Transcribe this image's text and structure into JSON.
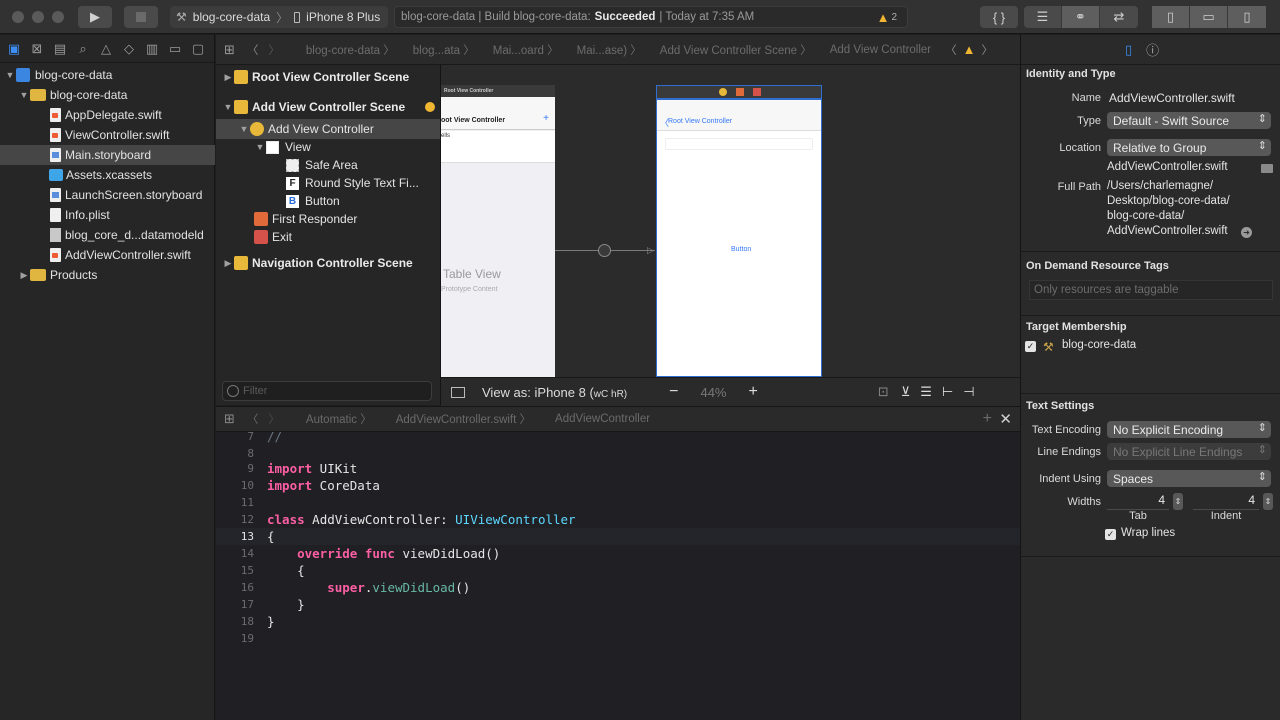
{
  "toolbar": {
    "scheme_target": "blog-core-data",
    "scheme_device": "iPhone 8 Plus",
    "status_prefix": "blog-core-data | Build blog-core-data:",
    "status_result": "Succeeded",
    "status_time": "| Today at 7:35 AM",
    "warning_count": "2"
  },
  "navigator": {
    "items": [
      {
        "label": "blog-core-data",
        "kind": "project"
      },
      {
        "label": "blog-core-data",
        "kind": "folder"
      },
      {
        "label": "AppDelegate.swift",
        "kind": "swift"
      },
      {
        "label": "ViewController.swift",
        "kind": "swift"
      },
      {
        "label": "Main.storyboard",
        "kind": "storyboard"
      },
      {
        "label": "Assets.xcassets",
        "kind": "assets"
      },
      {
        "label": "LaunchScreen.storyboard",
        "kind": "storyboard"
      },
      {
        "label": "Info.plist",
        "kind": "plist"
      },
      {
        "label": "blog_core_d...datamodeld",
        "kind": "datamodel"
      },
      {
        "label": "AddViewController.swift",
        "kind": "swift"
      },
      {
        "label": "Products",
        "kind": "folder"
      }
    ]
  },
  "jumpbar": {
    "crumbs": [
      "blog-core-data 〉",
      "blog...ata 〉",
      "Mai...oard 〉",
      "Mai...ase) 〉",
      "Add View Controller Scene 〉",
      "Add View Controller"
    ]
  },
  "outline": {
    "scene1": "Root View Controller Scene",
    "scene2": "Add View Controller Scene",
    "vc": "Add View Controller",
    "view": "View",
    "safe_area": "Safe Area",
    "textfield": "Round Style Text Fi...",
    "button": "Button",
    "first_responder": "First Responder",
    "exit": "Exit",
    "scene3": "Navigation Controller Scene",
    "filter_placeholder": "Filter",
    "tf_glyph": "F",
    "btn_glyph": "B"
  },
  "canvas": {
    "root_scene_title": "Root View Controller",
    "root_nav_title": "oot View Controller",
    "cells_label": "ells",
    "table_view": "Table View",
    "prototype": "Prototype Content",
    "back_label": "Root View Controller",
    "button_text": "Button",
    "view_as": "View as: iPhone 8 (",
    "view_as_compact": "wC hR)",
    "zoom": "44%"
  },
  "editor": {
    "jump": [
      "Automatic 〉",
      "AddViewController.swift 〉",
      "AddViewController"
    ],
    "lines": [
      {
        "n": "7",
        "text": "//"
      },
      {
        "n": "8",
        "text": ""
      },
      {
        "n": "9",
        "text": "import UIKit"
      },
      {
        "n": "10",
        "text": "import CoreData"
      },
      {
        "n": "11",
        "text": ""
      },
      {
        "n": "12",
        "text": "class AddViewController: UIViewController"
      },
      {
        "n": "13",
        "text": "{"
      },
      {
        "n": "14",
        "text": "    override func viewDidLoad()"
      },
      {
        "n": "15",
        "text": "    {"
      },
      {
        "n": "16",
        "text": "        super.viewDidLoad()"
      },
      {
        "n": "17",
        "text": "    }"
      },
      {
        "n": "18",
        "text": "}"
      },
      {
        "n": "19",
        "text": ""
      }
    ],
    "current_line": "13"
  },
  "inspector": {
    "identity_title": "Identity and Type",
    "name_label": "Name",
    "name_value": "AddViewController.swift",
    "type_label": "Type",
    "type_value": "Default - Swift Source",
    "location_label": "Location",
    "location_value": "Relative to Group",
    "location_file": "AddViewController.swift",
    "fullpath_label": "Full Path",
    "fullpath_lines": [
      "/Users/charlemagne/",
      "Desktop/blog-core-data/",
      "blog-core-data/",
      "AddViewController.swift"
    ],
    "odr_title": "On Demand Resource Tags",
    "odr_placeholder": "Only resources are taggable",
    "target_title": "Target Membership",
    "target_name": "blog-core-data",
    "text_title": "Text Settings",
    "encoding_label": "Text Encoding",
    "encoding_value": "No Explicit Encoding",
    "endings_label": "Line Endings",
    "endings_value": "No Explicit Line Endings",
    "indent_label": "Indent Using",
    "indent_value": "Spaces",
    "widths_label": "Widths",
    "tab_value": "4",
    "indent_width_value": "4",
    "tab_label": "Tab",
    "indent_sub_label": "Indent",
    "wrap_label": "Wrap lines"
  },
  "colors": {
    "accent": "#3c8ef3",
    "keyword": "#fc5fa3",
    "type": "#5dd8ff",
    "warning": "#f0b632"
  }
}
